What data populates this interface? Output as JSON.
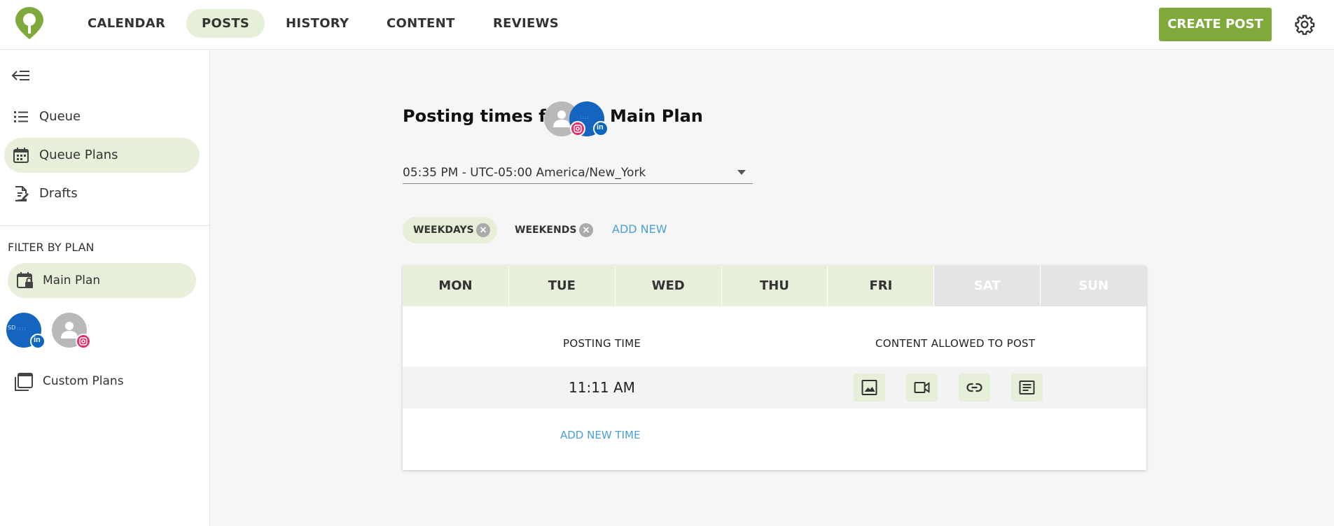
{
  "header": {
    "nav": [
      "CALENDAR",
      "POSTS",
      "HISTORY",
      "CONTENT",
      "REVIEWS"
    ],
    "active_nav": "POSTS",
    "create_button": "CREATE POST",
    "brand_color": "#7fa93a"
  },
  "sidebar": {
    "items": [
      {
        "label": "Queue",
        "icon": "list-icon"
      },
      {
        "label": "Queue Plans",
        "icon": "calendar-icon",
        "active": true
      },
      {
        "label": "Drafts",
        "icon": "document-edit-icon"
      }
    ],
    "filter_title": "FILTER BY PLAN",
    "plan": {
      "label": "Main Plan",
      "icon": "calendar-lock-icon"
    },
    "accounts": [
      {
        "network": "linkedin",
        "avatar_text": "SD",
        "badge_icon": "linkedin-icon"
      },
      {
        "network": "instagram",
        "avatar_text": "",
        "badge_icon": "instagram-icon"
      }
    ],
    "custom_plans": "Custom Plans"
  },
  "main": {
    "heading": "Posting times for:",
    "plan_name": "Main Plan",
    "timezone": "05:35 PM - UTC-05:00 America/New_York",
    "chips": [
      {
        "label": "WEEKDAYS",
        "active": true
      },
      {
        "label": "WEEKENDS",
        "active": false
      }
    ],
    "add_new": "ADD NEW",
    "days": [
      {
        "label": "MON",
        "enabled": true
      },
      {
        "label": "TUE",
        "enabled": true
      },
      {
        "label": "WED",
        "enabled": true
      },
      {
        "label": "THU",
        "enabled": true
      },
      {
        "label": "FRI",
        "enabled": true
      },
      {
        "label": "SAT",
        "enabled": false
      },
      {
        "label": "SUN",
        "enabled": false
      }
    ],
    "posting_time_header": "POSTING TIME",
    "content_allowed_header": "CONTENT ALLOWED TO POST",
    "times": [
      {
        "time": "11:11 AM",
        "content_types": [
          "image-icon",
          "video-icon",
          "link-icon",
          "text-icon"
        ]
      }
    ],
    "add_new_time": "ADD NEW TIME"
  }
}
